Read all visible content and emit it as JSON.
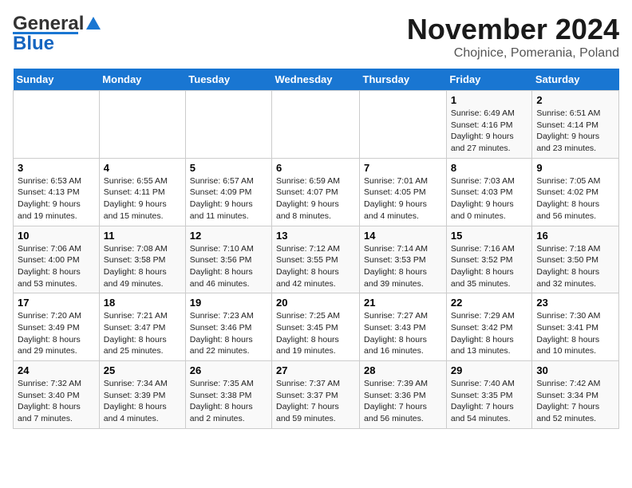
{
  "logo": {
    "general": "General",
    "blue": "Blue"
  },
  "title": {
    "month": "November 2024",
    "location": "Chojnice, Pomerania, Poland"
  },
  "days_of_week": [
    "Sunday",
    "Monday",
    "Tuesday",
    "Wednesday",
    "Thursday",
    "Friday",
    "Saturday"
  ],
  "weeks": [
    [
      {
        "day": "",
        "info": ""
      },
      {
        "day": "",
        "info": ""
      },
      {
        "day": "",
        "info": ""
      },
      {
        "day": "",
        "info": ""
      },
      {
        "day": "",
        "info": ""
      },
      {
        "day": "1",
        "info": "Sunrise: 6:49 AM\nSunset: 4:16 PM\nDaylight: 9 hours\nand 27 minutes."
      },
      {
        "day": "2",
        "info": "Sunrise: 6:51 AM\nSunset: 4:14 PM\nDaylight: 9 hours\nand 23 minutes."
      }
    ],
    [
      {
        "day": "3",
        "info": "Sunrise: 6:53 AM\nSunset: 4:13 PM\nDaylight: 9 hours\nand 19 minutes."
      },
      {
        "day": "4",
        "info": "Sunrise: 6:55 AM\nSunset: 4:11 PM\nDaylight: 9 hours\nand 15 minutes."
      },
      {
        "day": "5",
        "info": "Sunrise: 6:57 AM\nSunset: 4:09 PM\nDaylight: 9 hours\nand 11 minutes."
      },
      {
        "day": "6",
        "info": "Sunrise: 6:59 AM\nSunset: 4:07 PM\nDaylight: 9 hours\nand 8 minutes."
      },
      {
        "day": "7",
        "info": "Sunrise: 7:01 AM\nSunset: 4:05 PM\nDaylight: 9 hours\nand 4 minutes."
      },
      {
        "day": "8",
        "info": "Sunrise: 7:03 AM\nSunset: 4:03 PM\nDaylight: 9 hours\nand 0 minutes."
      },
      {
        "day": "9",
        "info": "Sunrise: 7:05 AM\nSunset: 4:02 PM\nDaylight: 8 hours\nand 56 minutes."
      }
    ],
    [
      {
        "day": "10",
        "info": "Sunrise: 7:06 AM\nSunset: 4:00 PM\nDaylight: 8 hours\nand 53 minutes."
      },
      {
        "day": "11",
        "info": "Sunrise: 7:08 AM\nSunset: 3:58 PM\nDaylight: 8 hours\nand 49 minutes."
      },
      {
        "day": "12",
        "info": "Sunrise: 7:10 AM\nSunset: 3:56 PM\nDaylight: 8 hours\nand 46 minutes."
      },
      {
        "day": "13",
        "info": "Sunrise: 7:12 AM\nSunset: 3:55 PM\nDaylight: 8 hours\nand 42 minutes."
      },
      {
        "day": "14",
        "info": "Sunrise: 7:14 AM\nSunset: 3:53 PM\nDaylight: 8 hours\nand 39 minutes."
      },
      {
        "day": "15",
        "info": "Sunrise: 7:16 AM\nSunset: 3:52 PM\nDaylight: 8 hours\nand 35 minutes."
      },
      {
        "day": "16",
        "info": "Sunrise: 7:18 AM\nSunset: 3:50 PM\nDaylight: 8 hours\nand 32 minutes."
      }
    ],
    [
      {
        "day": "17",
        "info": "Sunrise: 7:20 AM\nSunset: 3:49 PM\nDaylight: 8 hours\nand 29 minutes."
      },
      {
        "day": "18",
        "info": "Sunrise: 7:21 AM\nSunset: 3:47 PM\nDaylight: 8 hours\nand 25 minutes."
      },
      {
        "day": "19",
        "info": "Sunrise: 7:23 AM\nSunset: 3:46 PM\nDaylight: 8 hours\nand 22 minutes."
      },
      {
        "day": "20",
        "info": "Sunrise: 7:25 AM\nSunset: 3:45 PM\nDaylight: 8 hours\nand 19 minutes."
      },
      {
        "day": "21",
        "info": "Sunrise: 7:27 AM\nSunset: 3:43 PM\nDaylight: 8 hours\nand 16 minutes."
      },
      {
        "day": "22",
        "info": "Sunrise: 7:29 AM\nSunset: 3:42 PM\nDaylight: 8 hours\nand 13 minutes."
      },
      {
        "day": "23",
        "info": "Sunrise: 7:30 AM\nSunset: 3:41 PM\nDaylight: 8 hours\nand 10 minutes."
      }
    ],
    [
      {
        "day": "24",
        "info": "Sunrise: 7:32 AM\nSunset: 3:40 PM\nDaylight: 8 hours\nand 7 minutes."
      },
      {
        "day": "25",
        "info": "Sunrise: 7:34 AM\nSunset: 3:39 PM\nDaylight: 8 hours\nand 4 minutes."
      },
      {
        "day": "26",
        "info": "Sunrise: 7:35 AM\nSunset: 3:38 PM\nDaylight: 8 hours\nand 2 minutes."
      },
      {
        "day": "27",
        "info": "Sunrise: 7:37 AM\nSunset: 3:37 PM\nDaylight: 7 hours\nand 59 minutes."
      },
      {
        "day": "28",
        "info": "Sunrise: 7:39 AM\nSunset: 3:36 PM\nDaylight: 7 hours\nand 56 minutes."
      },
      {
        "day": "29",
        "info": "Sunrise: 7:40 AM\nSunset: 3:35 PM\nDaylight: 7 hours\nand 54 minutes."
      },
      {
        "day": "30",
        "info": "Sunrise: 7:42 AM\nSunset: 3:34 PM\nDaylight: 7 hours\nand 52 minutes."
      }
    ]
  ]
}
